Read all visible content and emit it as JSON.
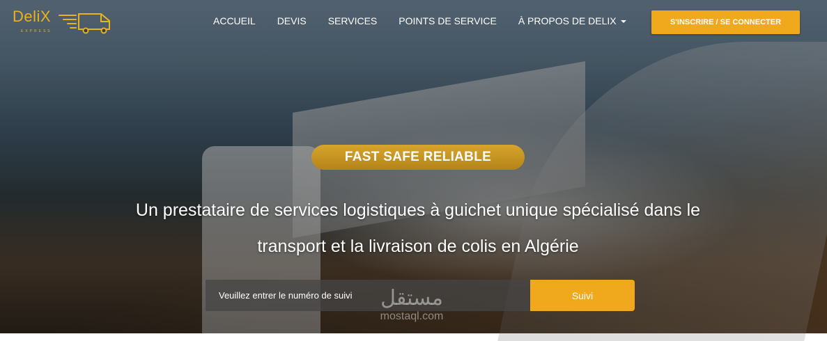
{
  "brand": {
    "name": "DeliX",
    "tagline": "EXPRESS",
    "accent_color": "#f0a91c",
    "icon": "delivery-van-icon"
  },
  "nav": {
    "items": [
      {
        "label": "ACCUEIL"
      },
      {
        "label": "DEVIS"
      },
      {
        "label": "SERVICES"
      },
      {
        "label": "POINTS DE SERVICE"
      },
      {
        "label": "À PROPOS DE DELIX",
        "dropdown": true
      }
    ],
    "cta_label": "S'INSCRIRE / SE CONNECTER"
  },
  "hero": {
    "badge": "FAST SAFE RELIABLE",
    "headline_line1": "Un prestataire de services logistiques à guichet unique spécialisé dans le",
    "headline_line2": "transport et la livraison de colis en Algérie"
  },
  "tracking": {
    "placeholder": "Veuillez entrer le numéro de suivi",
    "button_label": "Suivi"
  },
  "watermark": {
    "arabic": "مستقل",
    "latin": "mostaql.com"
  }
}
